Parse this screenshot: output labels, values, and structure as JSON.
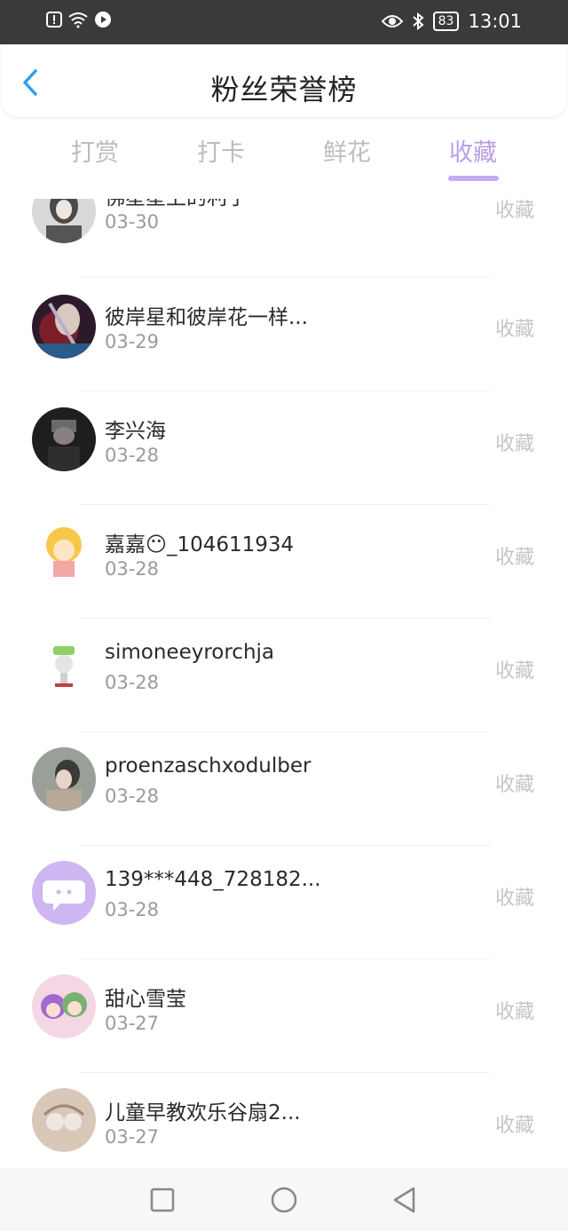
{
  "status_bar": {
    "time": "13:01",
    "battery": "83"
  },
  "header": {
    "title": "粉丝荣誉榜"
  },
  "tabs": [
    {
      "label": "打赏"
    },
    {
      "label": "打卡"
    },
    {
      "label": "鲜花"
    },
    {
      "label": "收藏",
      "active": true
    }
  ],
  "list": [
    {
      "name": "佛星星上的利子",
      "date": "03-30",
      "action": "收藏"
    },
    {
      "name": "彼岸星和彼岸花一样...",
      "date": "03-29",
      "action": "收藏"
    },
    {
      "name": "李兴海",
      "date": "03-28",
      "action": "收藏"
    },
    {
      "name": "嘉嘉😶_104611934",
      "date": "03-28",
      "action": "收藏"
    },
    {
      "name": "simoneeyrorchja",
      "date": "03-28",
      "action": "收藏"
    },
    {
      "name": "proenzaschxodulber",
      "date": "03-28",
      "action": "收藏"
    },
    {
      "name": "139***448_728182...",
      "date": "03-28",
      "action": "收藏"
    },
    {
      "name": "甜心雪莹",
      "date": "03-27",
      "action": "收藏"
    },
    {
      "name": "儿童早教欢乐谷扇2...",
      "date": "03-27",
      "action": "收藏"
    }
  ],
  "colors": {
    "accent": "#b99ee6",
    "back": "#2e9cf0"
  }
}
